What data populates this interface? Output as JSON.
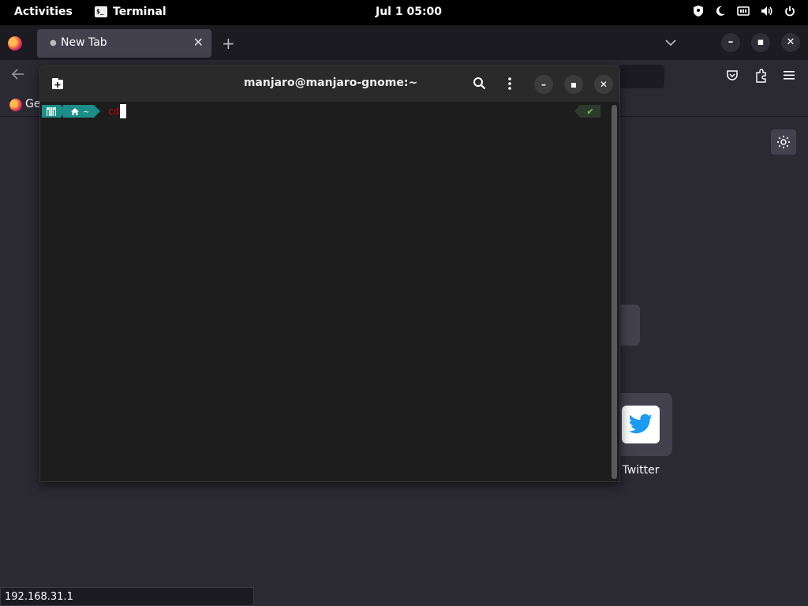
{
  "topbar": {
    "activities": "Activities",
    "app_name": "Terminal",
    "app_icon_glyph": "$_",
    "clock": "Jul 1  05:00",
    "tray_icons": [
      "privacy-indicator-icon",
      "night-light-icon",
      "network-icon",
      "volume-icon",
      "power-icon"
    ]
  },
  "firefox": {
    "tab_title": "New Tab",
    "tab_close": "✕",
    "new_tab": "+",
    "bookmark_first": "Ge",
    "shortcut_label": "Twitter",
    "status_url": "192.168.31.1",
    "colors": {
      "background": "#2b2a33",
      "tab_active": "#42414d",
      "toolbar_dark": "#1c1b22"
    }
  },
  "terminal": {
    "title": "manjaro@manjaro-gnome:~",
    "prompt_dir": "~",
    "command_text": "cd",
    "status_mark": "✔",
    "colors": {
      "prompt_segment": "#1b8e8a",
      "command": "#cc0000",
      "ok": "#6fcf45",
      "background": "#1d1d1d"
    }
  }
}
